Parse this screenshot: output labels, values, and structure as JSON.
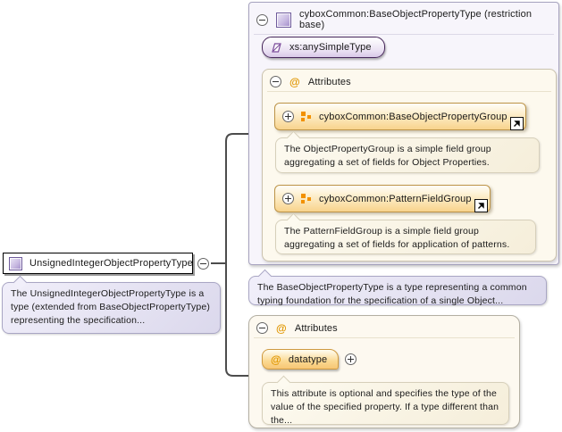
{
  "colors": {
    "accent_purple": "#a18bc9",
    "accent_orange": "#f29100",
    "panel_lavender": "#f7f5fb",
    "panel_cream": "#fdf9ee"
  },
  "icons": {
    "at": "@"
  },
  "element": {
    "name": "UnsignedIntegerObjectPropertyType",
    "annotation": "The UnsignedIntegerObjectPropertyType is a type (extended from BaseObjectPropertyType) representing the specification..."
  },
  "base_panel": {
    "title": "cyboxCommon:BaseObjectPropertyType (restriction base)",
    "base_type": "xs:anySimpleType",
    "attributes": {
      "label": "Attributes",
      "groups": [
        {
          "name": "cyboxCommon:BaseObjectPropertyGroup",
          "annotation": "The ObjectPropertyGroup is a simple field group aggregating a set of fields for Object Properties."
        },
        {
          "name": "cyboxCommon:PatternFieldGroup",
          "annotation": "The PatternFieldGroup is a simple field group aggregating a set of fields for application of patterns."
        }
      ]
    },
    "annotation": "The BaseObjectPropertyType is a type representing a common typing foundation for the specification of a single Object..."
  },
  "attributes_panel": {
    "label": "Attributes",
    "attribute": {
      "name": "datatype",
      "annotation": "This attribute is optional and specifies the type of the value of the specified property. If a type different than the..."
    }
  }
}
